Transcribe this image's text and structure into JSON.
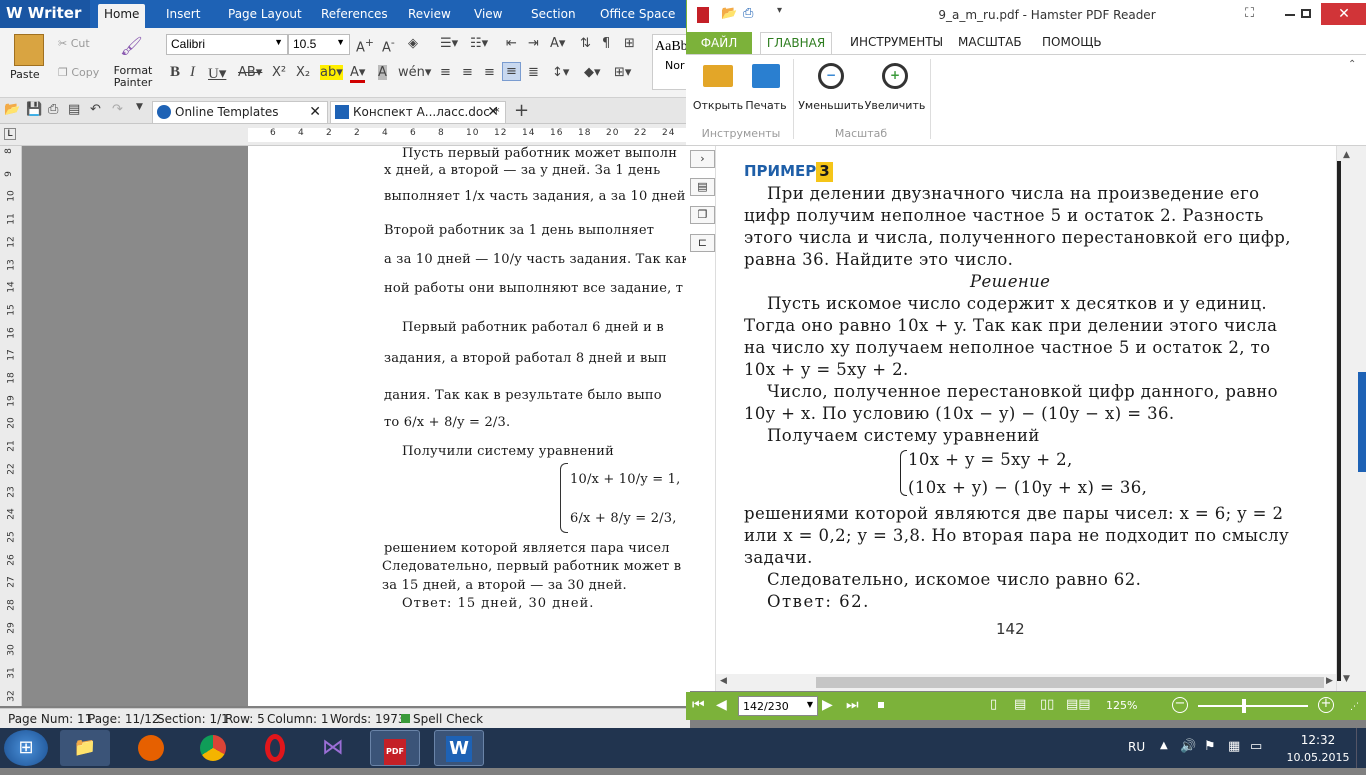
{
  "writer": {
    "app_name": "Writer",
    "tabs": [
      "Home",
      "Insert",
      "Page Layout",
      "References",
      "Review",
      "View",
      "Section",
      "Office Space"
    ],
    "ribbon": {
      "paste": "Paste",
      "cut": "Cut",
      "copy": "Copy",
      "format_painter": "Format Painter",
      "font_name": "Calibri",
      "font_size": "10.5",
      "style_preview": "AaBb",
      "style_name": "Nor"
    },
    "doc_tabs": [
      "Online Templates",
      "Конспект А...ласс.doc *"
    ],
    "ruler_numbers": [
      "6",
      "4",
      "2",
      "2",
      "4",
      "6",
      "8",
      "10",
      "12",
      "14",
      "16",
      "18",
      "20",
      "22",
      "24"
    ],
    "vruler_numbers": [
      "8",
      "9",
      "10",
      "11",
      "12",
      "13",
      "14",
      "15",
      "16",
      "17",
      "18",
      "19",
      "20",
      "21",
      "22",
      "23",
      "24",
      "25",
      "26",
      "27",
      "28",
      "29",
      "30",
      "31",
      "32"
    ],
    "doc_lines": [
      "Пусть первый работник может выполн",
      "x дней, а второй — за y дней. За 1 день",
      "выполняет  1/x  часть задания, а за 10 дней —",
      "Второй работник за 1 день выполняет",
      "а за 10 дней — 10/y часть задания. Так как з",
      "ной работы они выполняют все задание, т",
      "Первый работник работал 6 дней и в",
      "задания, а второй работал 8 дней и вып",
      "дания. Так как в результате было выпо",
      "то  6/x + 8/y = 2/3.",
      "Получили систему уравнений",
      "10/x + 10/y = 1,",
      "6/x + 8/y = 2/3,",
      "решением которой является пара чисел",
      "Следовательно, первый работник может в",
      "за 15 дней, а второй — за 30 дней.",
      "Ответ: 15 дней, 30 дней."
    ],
    "status": {
      "page_num": "Page Num: 11",
      "page": "Page: 11/12",
      "section": "Section: 1/1",
      "row": "Row: 5",
      "column": "Column: 1",
      "words": "Words: 1973",
      "spell": "Spell Check"
    }
  },
  "pdf": {
    "title": "9_a_m_ru.pdf - Hamster PDF Reader",
    "menu": [
      "ФАЙЛ",
      "ГЛАВНАЯ",
      "ИНСТРУМЕНТЫ",
      "МАСШТАБ",
      "ПОМОЩЬ"
    ],
    "buttons": {
      "open": "Открыть",
      "print": "Печать",
      "zoom_out": "Уменьшить",
      "zoom_in": "Увеличить"
    },
    "groups": {
      "tools": "Инструменты",
      "scale": "Масштаб"
    },
    "example_label": "ПРИМЕР",
    "example_num": "3",
    "lines": [
      "При делении двузначного числа на произведение его",
      "цифр получим неполное частное 5 и остаток 2. Разность",
      "этого числа и числа, полученного перестановкой его цифр,",
      "равна 36. Найдите это число.",
      "Решение",
      "Пусть искомое число содержит x десятков и y единиц.",
      "Тогда оно равно 10x + y. Так как при делении этого числа",
      "на число xy получаем неполное частное 5 и остаток 2, то",
      "10x + y = 5xy + 2.",
      "Число, полученное перестановкой цифр данного, равно",
      "10y + x. По условию (10x − y) − (10y − x) = 36.",
      "Получаем систему уравнений",
      "10x + y = 5xy + 2,",
      "(10x + y) − (10y + x) = 36,",
      "решениями которой являются две пары чисел: x = 6; y = 2",
      "или x = 0,2; y = 3,8. Но вторая пара не подходит по смыслу",
      "задачи.",
      "Следовательно, искомое число равно 62.",
      "Ответ: 62."
    ],
    "page_number": "142",
    "page_field": "142/230",
    "zoom": "125%"
  },
  "taskbar": {
    "lang": "RU",
    "time": "12:32",
    "date": "10.05.2015"
  }
}
